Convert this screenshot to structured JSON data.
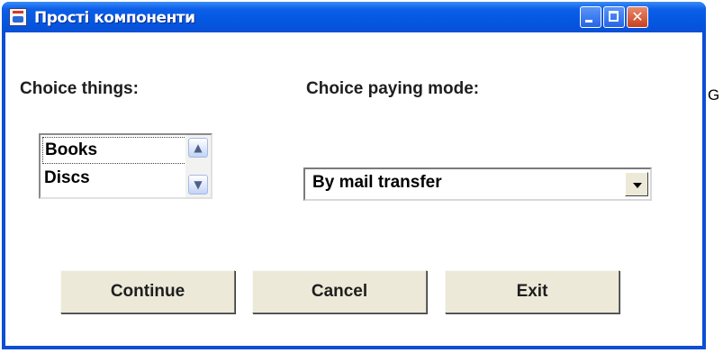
{
  "window": {
    "title": "Прості компоненти",
    "icon": "java-cup-icon"
  },
  "titlebar_buttons": {
    "minimize": "minimize-icon",
    "maximize": "maximize-icon",
    "close_glyph": "✕"
  },
  "choice_things": {
    "label": "Choice things:",
    "items": [
      "Books",
      "Discs"
    ],
    "scroll_up_glyph": "▲",
    "scroll_down_glyph": "▼"
  },
  "choice_paying": {
    "label": "Choice paying mode:",
    "selected": "By mail transfer"
  },
  "buttons": {
    "continue": "Continue",
    "cancel": "Cancel",
    "exit": "Exit"
  },
  "side_text": "G",
  "colors": {
    "titlebar": "#0a4fd6",
    "button_face": "#ece9d8",
    "close_button": "#c8401f"
  }
}
